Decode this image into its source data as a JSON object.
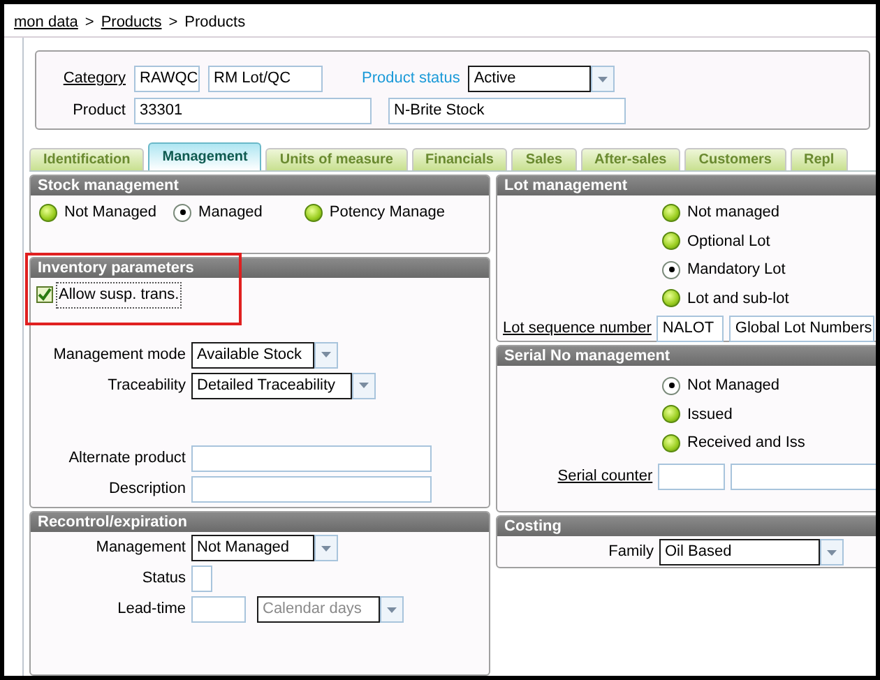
{
  "breadcrumb": {
    "items": [
      {
        "text": "mon data",
        "link": true
      },
      {
        "text": "Products",
        "link": true
      },
      {
        "text": "Products",
        "link": false
      }
    ],
    "separator": ">"
  },
  "header": {
    "category_label": "Category",
    "category_code": "RAWQC",
    "category_name": "RM Lot/QC",
    "status_label": "Product status",
    "status_value": "Active",
    "product_label": "Product",
    "product_code": "33301",
    "product_description": "N-Brite Stock"
  },
  "tabs": [
    {
      "label": "Identification",
      "selected": false
    },
    {
      "label": "Management",
      "selected": true
    },
    {
      "label": "Units of measure",
      "selected": false
    },
    {
      "label": "Financials",
      "selected": false
    },
    {
      "label": "Sales",
      "selected": false
    },
    {
      "label": "After-sales",
      "selected": false
    },
    {
      "label": "Customers",
      "selected": false
    },
    {
      "label": "Repl",
      "selected": false
    }
  ],
  "stock_management": {
    "title": "Stock management",
    "options": [
      {
        "label": "Not Managed",
        "selected": false
      },
      {
        "label": "Managed",
        "selected": true
      },
      {
        "label": "Potency Manage",
        "selected": false
      }
    ]
  },
  "inventory_parameters": {
    "title": "Inventory parameters",
    "allow_susp": {
      "label": "Allow susp. trans.",
      "checked": true
    },
    "management_mode": {
      "label": "Management mode",
      "value": "Available Stock"
    },
    "traceability": {
      "label": "Traceability",
      "value": "Detailed Traceability"
    },
    "alternate_product": {
      "label": "Alternate product"
    },
    "description": {
      "label": "Description"
    }
  },
  "recontrol": {
    "title": "Recontrol/expiration",
    "management": {
      "label": "Management",
      "value": "Not Managed"
    },
    "status": {
      "label": "Status"
    },
    "lead_time": {
      "label": "Lead-time",
      "unit": "Calendar days",
      "disabled": true
    }
  },
  "lot_management": {
    "title": "Lot management",
    "options": [
      {
        "label": "Not managed",
        "selected": false
      },
      {
        "label": "Optional Lot",
        "selected": false
      },
      {
        "label": "Mandatory Lot",
        "selected": true
      },
      {
        "label": "Lot and sub-lot",
        "selected": false
      }
    ],
    "sequence_label": "Lot sequence number",
    "sequence_code": "NALOT",
    "sequence_name": "Global Lot Numbers"
  },
  "serial_management": {
    "title": "Serial No management",
    "options": [
      {
        "label": "Not Managed",
        "selected": true
      },
      {
        "label": "Issued",
        "selected": false
      },
      {
        "label": "Received and Iss",
        "selected": false
      }
    ],
    "counter_label": "Serial counter"
  },
  "costing": {
    "title": "Costing",
    "family": {
      "label": "Family",
      "value": "Oil Based"
    }
  }
}
